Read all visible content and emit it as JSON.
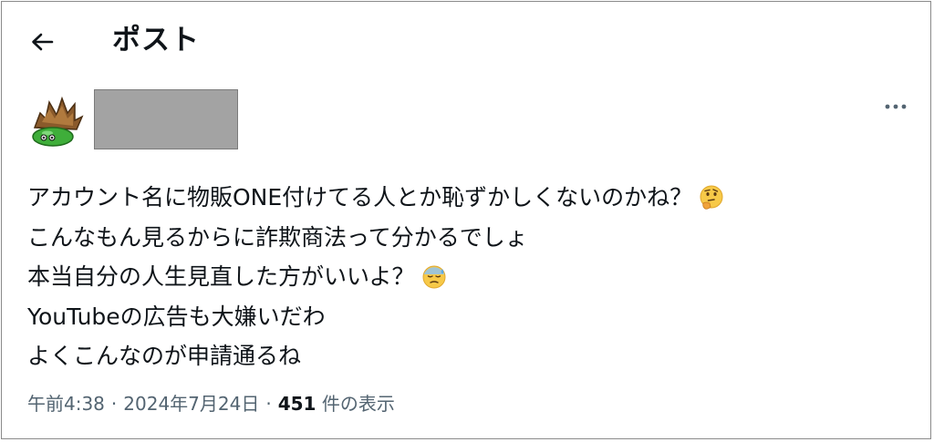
{
  "header": {
    "back_icon": "arrow-left-icon",
    "title": "ポスト"
  },
  "author": {
    "avatar_icon": "slime-avatar-icon",
    "more_icon": "more-horizontal-icon"
  },
  "post": {
    "lines": [
      {
        "text": "アカウント名に物販ONE付けてる人とか恥ずかしくないのかね？",
        "emoji": "thinking-face-emoji"
      },
      {
        "text": "こんなもん見るからに詐欺商法って分かるでしょ",
        "emoji": null
      },
      {
        "text": "本当自分の人生見直した方がいいよ？",
        "emoji": "downcast-sweat-face-emoji"
      },
      {
        "text": "YouTubeの広告も大嫌いだわ",
        "emoji": null
      },
      {
        "text": "よくこんなのが申請通るね",
        "emoji": null
      }
    ]
  },
  "meta": {
    "time": "午前4:38",
    "separator": "·",
    "date": "2024年7月24日",
    "views_count": "451",
    "views_label": " 件の表示"
  }
}
